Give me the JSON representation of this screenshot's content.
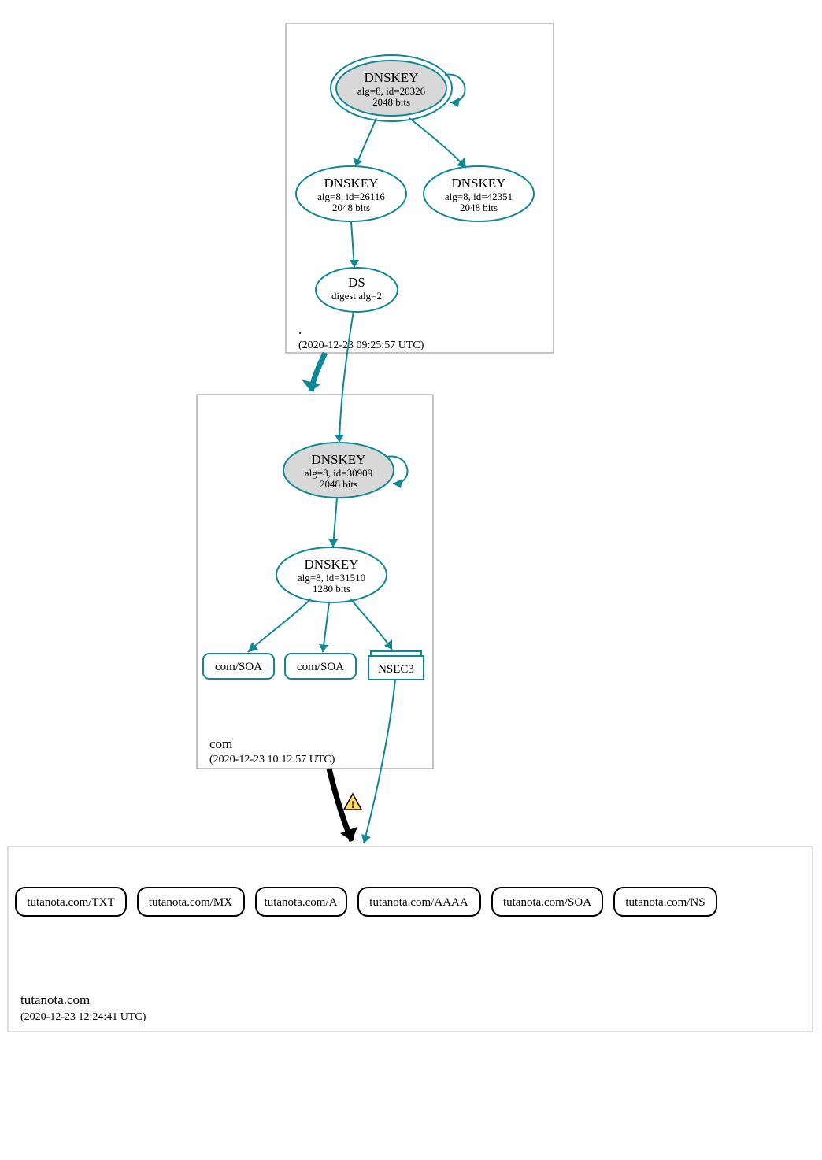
{
  "zones": {
    "root": {
      "label": ".",
      "timestamp": "(2020-12-23 09:25:57 UTC)"
    },
    "com": {
      "label": "com",
      "timestamp": "(2020-12-23 10:12:57 UTC)"
    },
    "tutanota": {
      "label": "tutanota.com",
      "timestamp": "(2020-12-23 12:24:41 UTC)"
    }
  },
  "nodes": {
    "root_ksk": {
      "title": "DNSKEY",
      "line2": "alg=8, id=20326",
      "line3": "2048 bits"
    },
    "root_zsk1": {
      "title": "DNSKEY",
      "line2": "alg=8, id=26116",
      "line3": "2048 bits"
    },
    "root_zsk2": {
      "title": "DNSKEY",
      "line2": "alg=8, id=42351",
      "line3": "2048 bits"
    },
    "root_ds": {
      "title": "DS",
      "line2": "digest alg=2"
    },
    "com_ksk": {
      "title": "DNSKEY",
      "line2": "alg=8, id=30909",
      "line3": "2048 bits"
    },
    "com_zsk": {
      "title": "DNSKEY",
      "line2": "alg=8, id=31510",
      "line3": "1280 bits"
    },
    "com_soa1": "com/SOA",
    "com_soa2": "com/SOA",
    "com_nsec3": "NSEC3",
    "leaf_txt": "tutanota.com/TXT",
    "leaf_mx": "tutanota.com/MX",
    "leaf_a": "tutanota.com/A",
    "leaf_aaaa": "tutanota.com/AAAA",
    "leaf_soa": "tutanota.com/SOA",
    "leaf_ns": "tutanota.com/NS"
  },
  "colors": {
    "teal": "#0d8894",
    "gray_fill": "#d8d8d8",
    "warn": "#ffd966"
  }
}
